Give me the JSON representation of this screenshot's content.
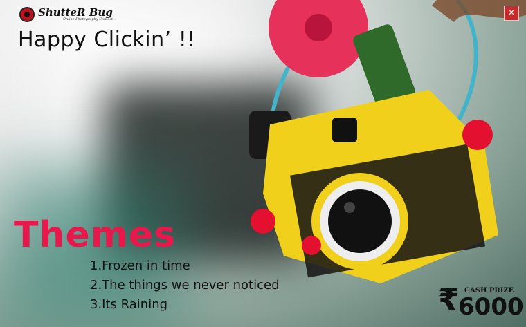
{
  "brand": {
    "name": "ShutteR Bug",
    "tagline": "Online Photography Contest"
  },
  "headline": "Happy Clickin’ !!",
  "close_label": "×",
  "themes": {
    "title": "Themes",
    "items": [
      "1.Frozen in time",
      "2.The things we never noticed",
      "3.Its Raining"
    ]
  },
  "prize": {
    "label": "CASH PRIZE",
    "currency_symbol": "₹",
    "amount": "6000"
  },
  "colors": {
    "accent": "#e8184d",
    "close": "#c62b2b",
    "camera_body": "#f1d01c",
    "ring": "#e6325a",
    "strap": "#43b3c9"
  },
  "icons": {
    "close": "close-icon",
    "logo": "ladybug-logo-icon"
  }
}
